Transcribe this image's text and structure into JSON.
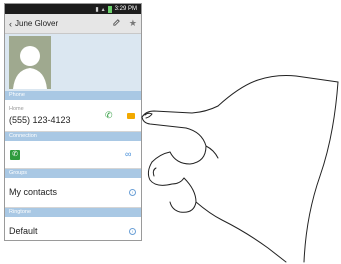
{
  "status_bar": {
    "time": "3:29 PM"
  },
  "header": {
    "title": "June Glover",
    "icons": [
      "back-icon",
      "edit-icon",
      "star-icon"
    ]
  },
  "sections": {
    "phone": "Phone",
    "connection": "Connection",
    "groups": "Groups",
    "ringtone": "Ringtone"
  },
  "phone_entry": {
    "type": "Home",
    "number": "(555) 123-4123"
  },
  "groups_value": "My contacts",
  "ringtone_value": "Default",
  "colors": {
    "section_header": "#a9c8e4",
    "call_green": "#2e9b3d",
    "message_yellow": "#f2a900",
    "photo_background": "#dbe7f1"
  }
}
